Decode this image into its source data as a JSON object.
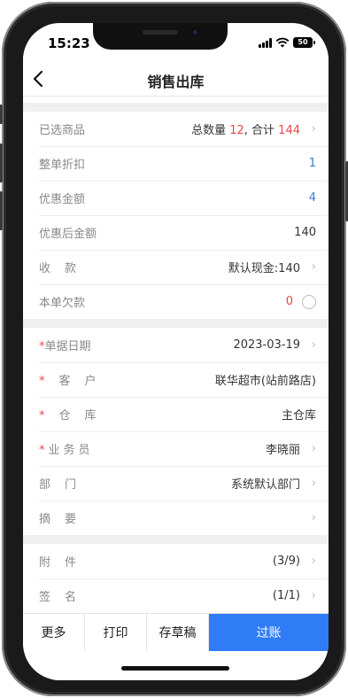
{
  "status": {
    "time": "15:23",
    "battery": "50"
  },
  "nav": {
    "title": "销售出库"
  },
  "summary": {
    "selected_label": "已选商品",
    "selected_prefix": "总数量 ",
    "selected_qty": "12",
    "selected_mid": ", 合计 ",
    "selected_total": "144",
    "discount_label": "整单折扣",
    "discount_value": "1",
    "promo_label": "优惠金额",
    "promo_value": "4",
    "after_label": "优惠后金额",
    "after_value": "140",
    "receipt_label": "收款",
    "receipt_value": "默认现金:140",
    "debt_label": "本单欠款",
    "debt_value": "0"
  },
  "info": {
    "date_label": "单据日期",
    "date_value": "2023-03-19",
    "customer_label": "客户",
    "customer_value": "联华超市(站前路店)",
    "warehouse_label": "仓库",
    "warehouse_value": "主仓库",
    "salesman_label": "业务员",
    "salesman_value": "李晓丽",
    "dept_label": "部门",
    "dept_value": "系统默认部门",
    "memo_label": "摘要",
    "memo_value": ""
  },
  "extra": {
    "attach_label": "附件",
    "attach_value": "(3/9)",
    "sign_label": "签名",
    "sign_value": "(1/1)"
  },
  "actions": {
    "more": "更多",
    "print": "打印",
    "draft": "存草稿",
    "post": "过账"
  },
  "colors": {
    "primary": "#2f7cf6",
    "required": "#e54848",
    "link_blue": "#3a7bd5"
  }
}
